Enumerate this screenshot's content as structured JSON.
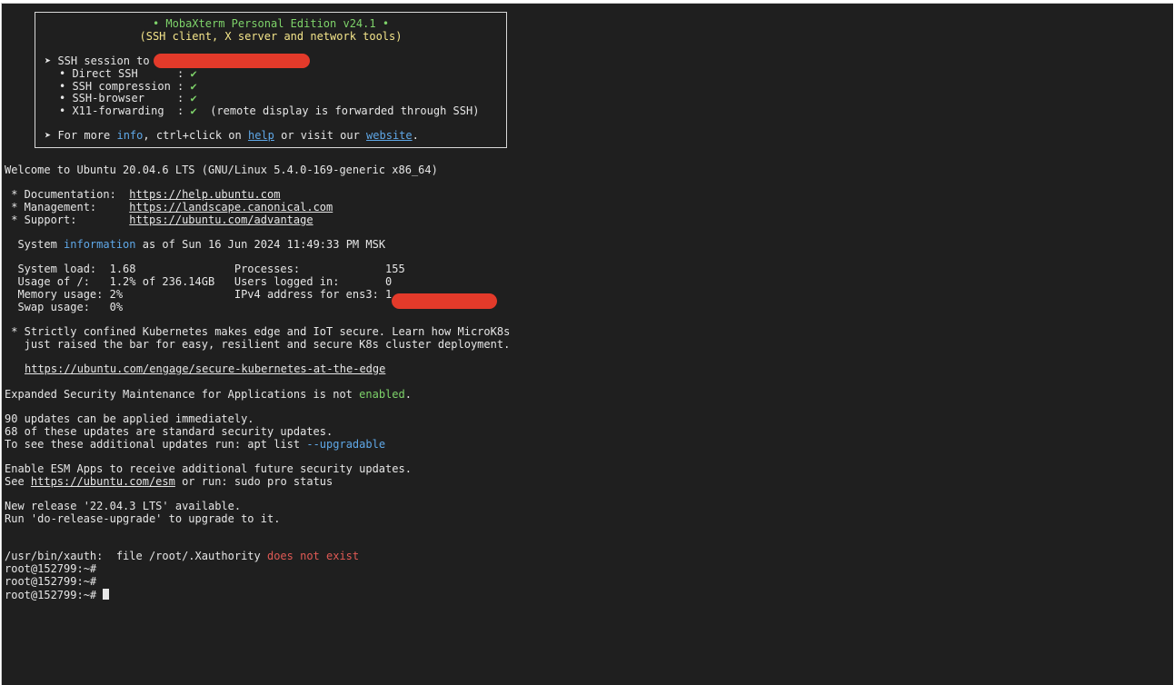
{
  "banner": {
    "title": "• MobaXterm Personal Edition v24.1 •",
    "subtitle": "(SSH client, X server and network tools)",
    "session_prefix": "➤ SSH session to",
    "features": [
      {
        "label": "• Direct SSH      :",
        "mark": "✔",
        "note": ""
      },
      {
        "label": "• SSH compression :",
        "mark": "✔",
        "note": ""
      },
      {
        "label": "• SSH-browser     :",
        "mark": "✔",
        "note": ""
      },
      {
        "label": "• X11-forwarding  :",
        "mark": "✔",
        "note": "(remote display is forwarded through SSH)"
      }
    ],
    "more_prefix": "➤ For more ",
    "info_word": "info",
    "more_mid": ", ctrl+click on ",
    "help_word": "help",
    "more_mid2": " or visit our ",
    "website_word": "website",
    "more_end": "."
  },
  "welcome": "Welcome to Ubuntu 20.04.6 LTS (GNU/Linux 5.4.0-169-generic x86_64)",
  "links": [
    {
      "label": " * Documentation:  ",
      "url": "https://help.ubuntu.com"
    },
    {
      "label": " * Management:     ",
      "url": "https://landscape.canonical.com"
    },
    {
      "label": " * Support:        ",
      "url": "https://ubuntu.com/advantage"
    }
  ],
  "sysinfo": {
    "prefix": "  System ",
    "word": "information",
    "suffix": " as of Sun 16 Jun 2024 11:49:33 PM MSK"
  },
  "stats": [
    "  System load:  1.68               Processes:             155",
    "  Usage of /:   1.2% of 236.14GB   Users logged in:       0",
    "  Memory usage: 2%                 IPv4 address for ens3: 1",
    "  Swap usage:   0%"
  ],
  "microk8s": [
    " * Strictly confined Kubernetes makes edge and IoT secure. Learn how MicroK8s",
    "   just raised the bar for easy, resilient and secure K8s cluster deployment."
  ],
  "microk8s_url": "https://ubuntu.com/engage/secure-kubernetes-at-the-edge",
  "esm": {
    "prefix": "Expanded Security Maintenance for Applications is not ",
    "word": "enabled",
    "suffix": "."
  },
  "updates": [
    "90 updates can be applied immediately.",
    "68 of these updates are standard security updates."
  ],
  "updates_cmd": {
    "prefix": "To see these additional updates run: apt list ",
    "flag": "--upgradable"
  },
  "esm_apps": "Enable ESM Apps to receive additional future security updates.",
  "esm_see": {
    "prefix": "See ",
    "url": "https://ubuntu.com/esm",
    "suffix": " or run: sudo pro status"
  },
  "release": [
    "New release '22.04.3 LTS' available.",
    "Run 'do-release-upgrade' to upgrade to it."
  ],
  "xauth": {
    "prefix": "/usr/bin/xauth:  file /root/.Xauthority ",
    "error": "does not exist"
  },
  "prompts": [
    "root@152799:~#",
    "root@152799:~#",
    "root@152799:~# "
  ],
  "colors": {
    "background": "#1f1f1f",
    "green": "#7ed36a",
    "blue": "#5fa8e8",
    "red": "#e05a55",
    "yellow": "#f3e48a",
    "redaction": "#e33a2a"
  }
}
